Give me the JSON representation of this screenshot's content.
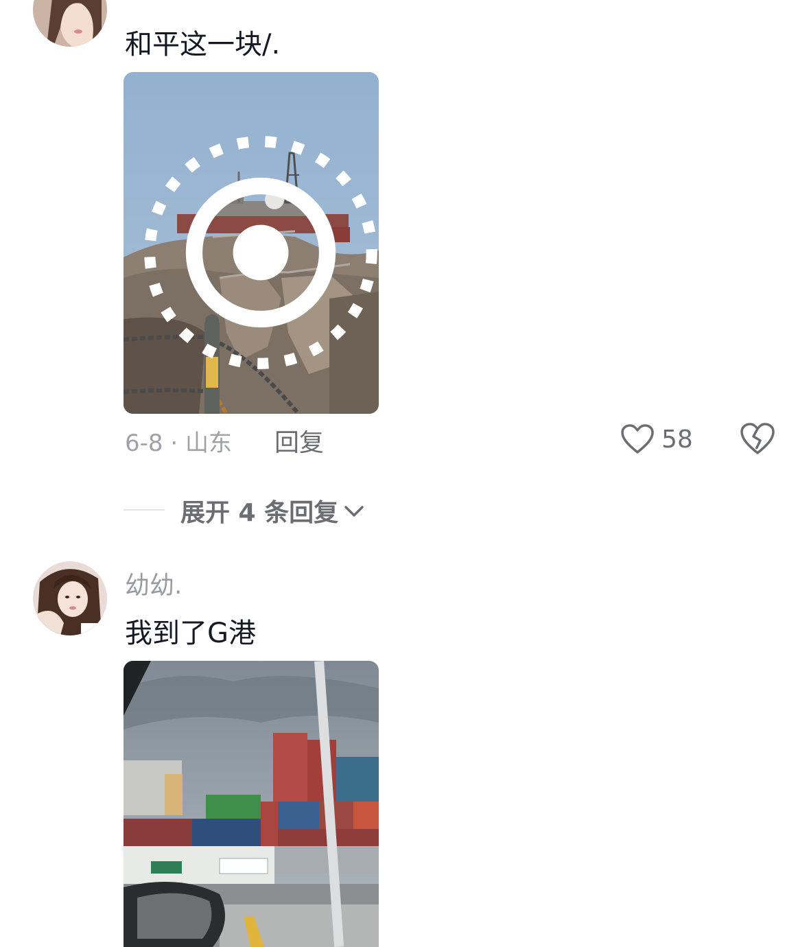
{
  "comments": [
    {
      "username": "",
      "text": "和平这一块/.",
      "photo": {
        "alt": "mountain-radar-station",
        "live_icon": "live-photo-icon"
      },
      "date_location": "6-8 · 山东",
      "reply_label": "回复",
      "like_count": "58",
      "expand_label": "展开 4 条回复"
    },
    {
      "username": "幼幼.",
      "text": "我到了G港",
      "photo": {
        "alt": "container-port-through-car-window"
      }
    }
  ],
  "colors": {
    "primary_text": "#161823",
    "secondary_text": "#9a9ba0",
    "action_text": "#6c6d72"
  },
  "icons": [
    "heart-icon",
    "broken-heart-icon",
    "chevron-down-icon",
    "live-photo-icon"
  ]
}
